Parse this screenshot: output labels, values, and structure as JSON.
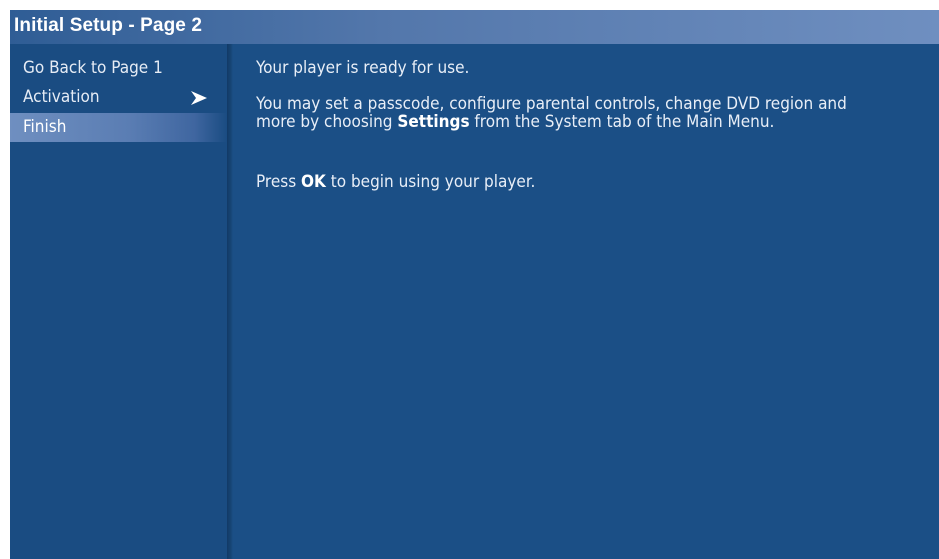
{
  "title": "Initial Setup - Page 2",
  "menu": {
    "items": [
      {
        "label": "Go Back to Page 1"
      },
      {
        "label": "Activation",
        "icon": "arrow-right-icon"
      },
      {
        "label": "Finish",
        "selected": true
      }
    ]
  },
  "content": {
    "p1": "Your player is ready for use.",
    "p2": {
      "line1": "You may set a passcode, configure parental controls, change DVD region and",
      "line2_before": "more by choosing ",
      "line2_bold": "Settings",
      "line2_after": " from the System tab of the Main Menu."
    },
    "p3": {
      "before": "Press ",
      "bold": "OK",
      "after": " to begin using your player."
    }
  },
  "colors": {
    "background": "#1b4f86",
    "title_bar": "#5377ab",
    "selected_item": "#6f8fc0",
    "text": "#e8eef7"
  }
}
